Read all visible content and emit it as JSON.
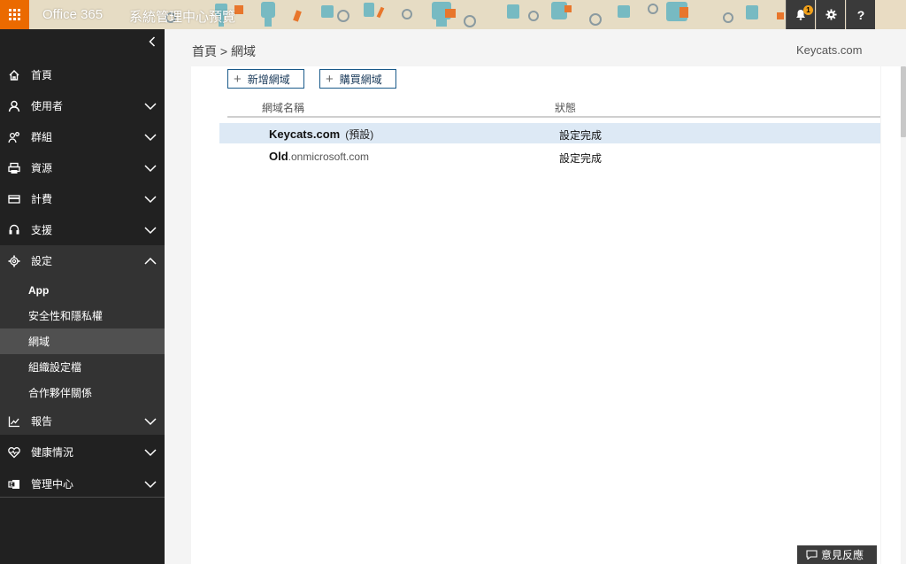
{
  "topbar": {
    "app_name": "Office 365",
    "title": "系統管理中心預覽",
    "notification_count": "1",
    "help_label": "?",
    "colors": {
      "waffle": "#eb6a00",
      "buttons": "#3a3a3a"
    }
  },
  "sidebar": {
    "items": [
      {
        "label": "首頁",
        "icon": "home-icon"
      },
      {
        "label": "使用者",
        "icon": "user-icon"
      },
      {
        "label": "群組",
        "icon": "group-icon"
      },
      {
        "label": "資源",
        "icon": "printer-icon"
      },
      {
        "label": "計費",
        "icon": "card-icon"
      },
      {
        "label": "支援",
        "icon": "headset-icon"
      },
      {
        "label": "設定",
        "icon": "gear-icon"
      },
      {
        "label": "報告",
        "icon": "chart-icon"
      },
      {
        "label": "健康情況",
        "icon": "heart-icon"
      },
      {
        "label": "管理中心",
        "icon": "exchange-icon"
      }
    ],
    "settings_sub": [
      {
        "label": "App"
      },
      {
        "label": "安全性和隱私權"
      },
      {
        "label": "網域"
      },
      {
        "label": "組織設定檔"
      },
      {
        "label": "合作夥伴關係"
      }
    ]
  },
  "main": {
    "breadcrumb": "首頁 > 網域",
    "tenant": "Keycats.com",
    "toolbar": {
      "add_label": "新增網域",
      "buy_label": "購買網域"
    },
    "table": {
      "headers": {
        "name": "網域名稱",
        "status": "狀態"
      },
      "rows": [
        {
          "name": "Keycats.com",
          "tag": "(預設)",
          "suffix": "",
          "status": "設定完成"
        },
        {
          "name": "Old",
          "tag": "",
          "suffix": ".onmicrosoft.com",
          "status": "設定完成"
        }
      ]
    },
    "feedback_label": "意見反應"
  }
}
